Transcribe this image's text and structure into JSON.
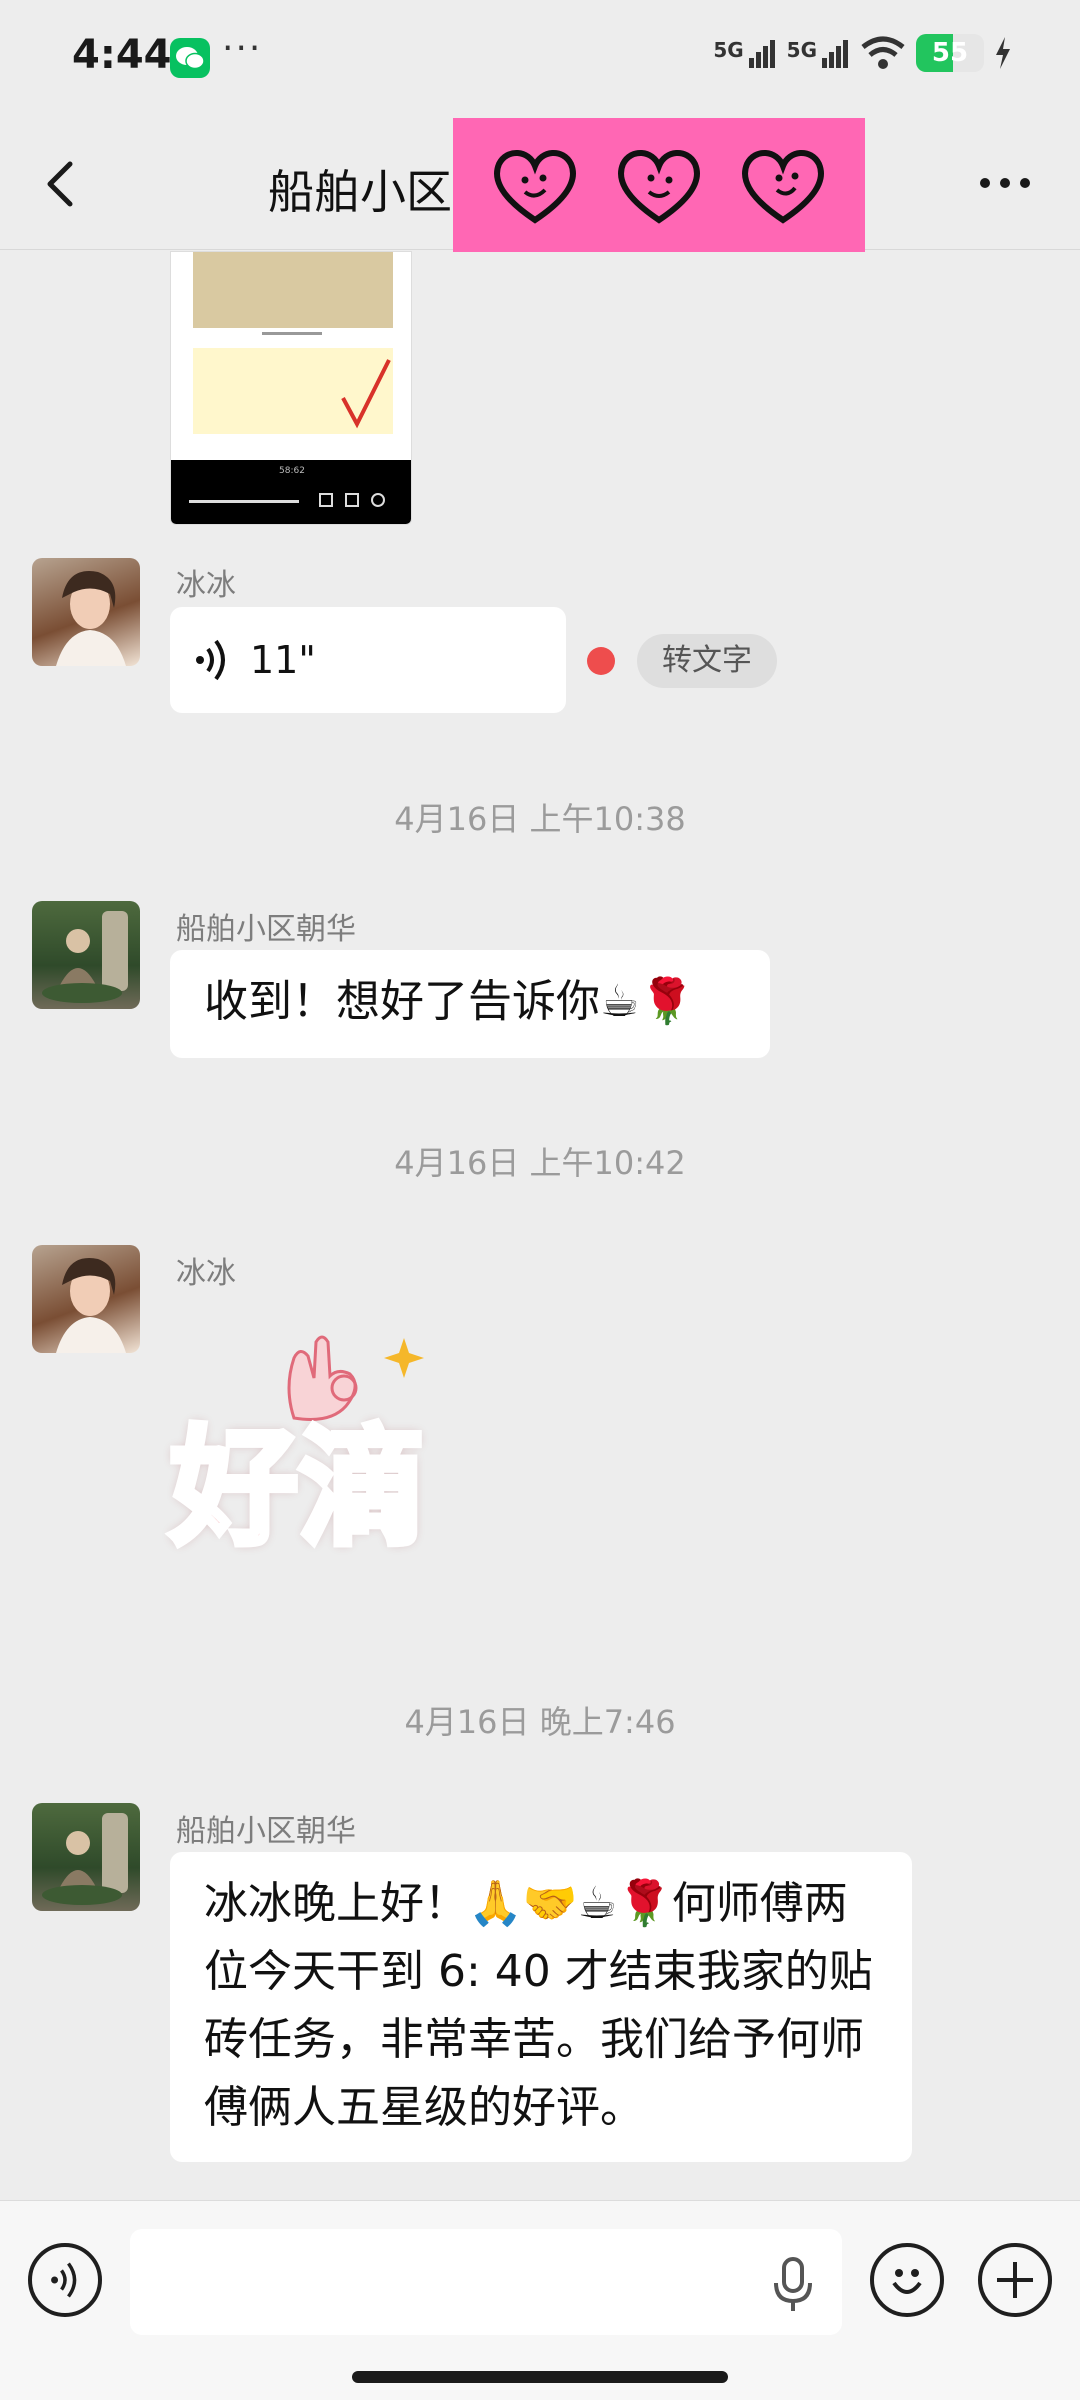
{
  "status": {
    "time": "4:44",
    "dots": "···",
    "net1": "5G",
    "net2": "5G",
    "battery": "55",
    "battery_level": 0.55
  },
  "header": {
    "title": "船舶小区"
  },
  "messages": [
    {
      "sender": "冰冰",
      "voice_duration": "11\"",
      "to_text": "转文字"
    },
    {
      "time": "4月16日 上午10:38"
    },
    {
      "sender": "船舶小区朝华",
      "text": "收到！想好了告诉你☕🌹"
    },
    {
      "time": "4月16日 上午10:42"
    },
    {
      "sender": "冰冰",
      "sticker_text": "好滴"
    },
    {
      "time": "4月16日 晚上7:46"
    },
    {
      "sender": "船舶小区朝华",
      "text": "冰冰晚上好！🙏🤝☕🌹何师傅两位今天干到 6: 40 才结束我家的贴砖任务，非常幸苦。我们给予何师傅俩人五星级的好评。"
    }
  ],
  "input": {
    "placeholder": ""
  },
  "preview": {
    "video_time": "58:62"
  },
  "colors": {
    "bg": "#ededed",
    "pink": "#ff67b4",
    "green": "#07c160",
    "red_dot": "#ee4d4d"
  }
}
